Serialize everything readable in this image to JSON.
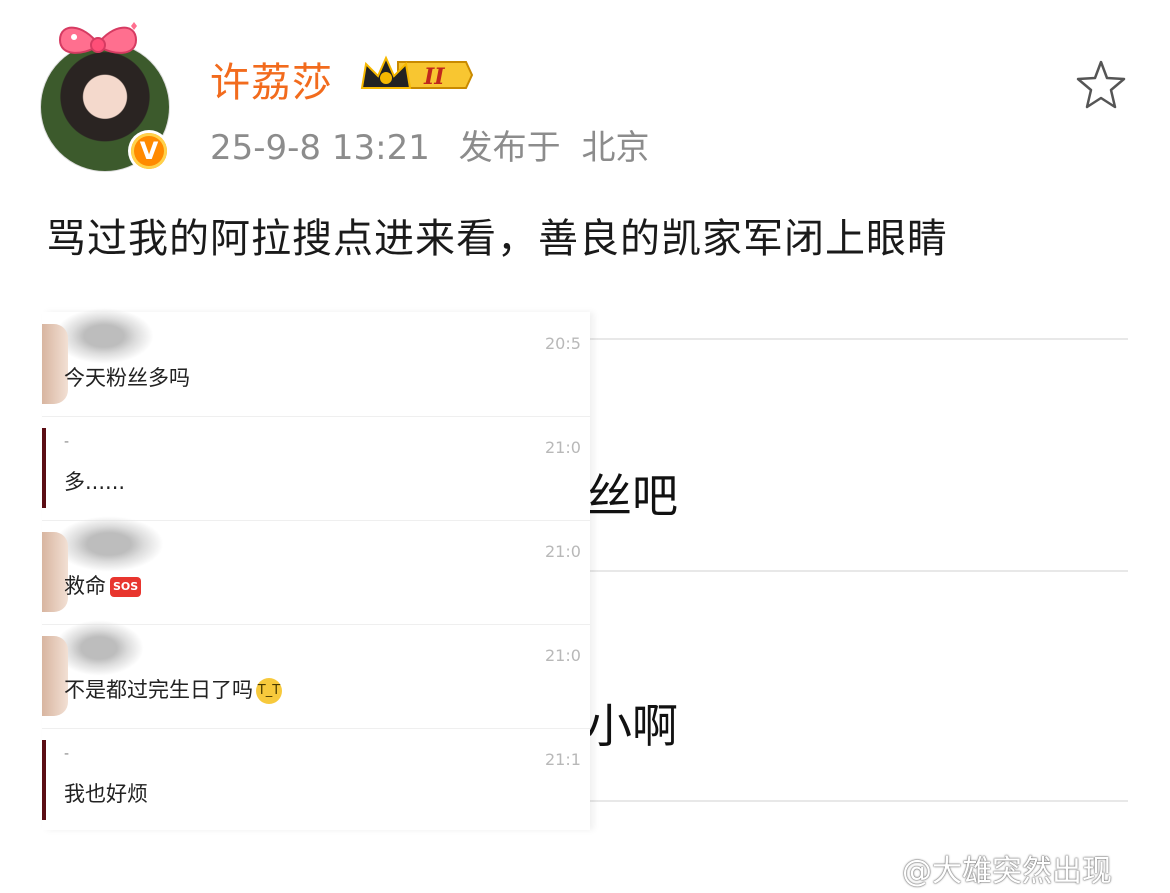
{
  "post": {
    "username": "许荔莎",
    "vip_level": "II",
    "timestamp": "25-9-8 13:21",
    "location_prefix": "发布于",
    "location": "北京",
    "text": "骂过我的阿拉搜点进来看，善良的凯家军闭上眼睛"
  },
  "background_screenshot": {
    "text_1": "丝吧",
    "text_2": "小啊"
  },
  "chat": {
    "rows": [
      {
        "time": "20:5",
        "sender": "",
        "message": "今天粉丝多吗",
        "emoji": ""
      },
      {
        "time": "21:0",
        "sender": "-",
        "message": "多......",
        "emoji": ""
      },
      {
        "time": "21:0",
        "sender": "",
        "message": "救命",
        "emoji": "SOS"
      },
      {
        "time": "21:0",
        "sender": "",
        "message": "不是都过完生日了吗",
        "emoji": "😭"
      },
      {
        "time": "21:1",
        "sender": "-",
        "message": "我也好烦",
        "emoji": ""
      }
    ]
  },
  "watermark": "@大雄突然出现",
  "colors": {
    "username": "#f26b1d",
    "meta": "#8c8c8c",
    "verified_badge": "#ff8a00"
  },
  "icons": {
    "favorite": "star-outline-icon",
    "verified": "verified-v-icon",
    "vip": "crown-badge-icon"
  }
}
